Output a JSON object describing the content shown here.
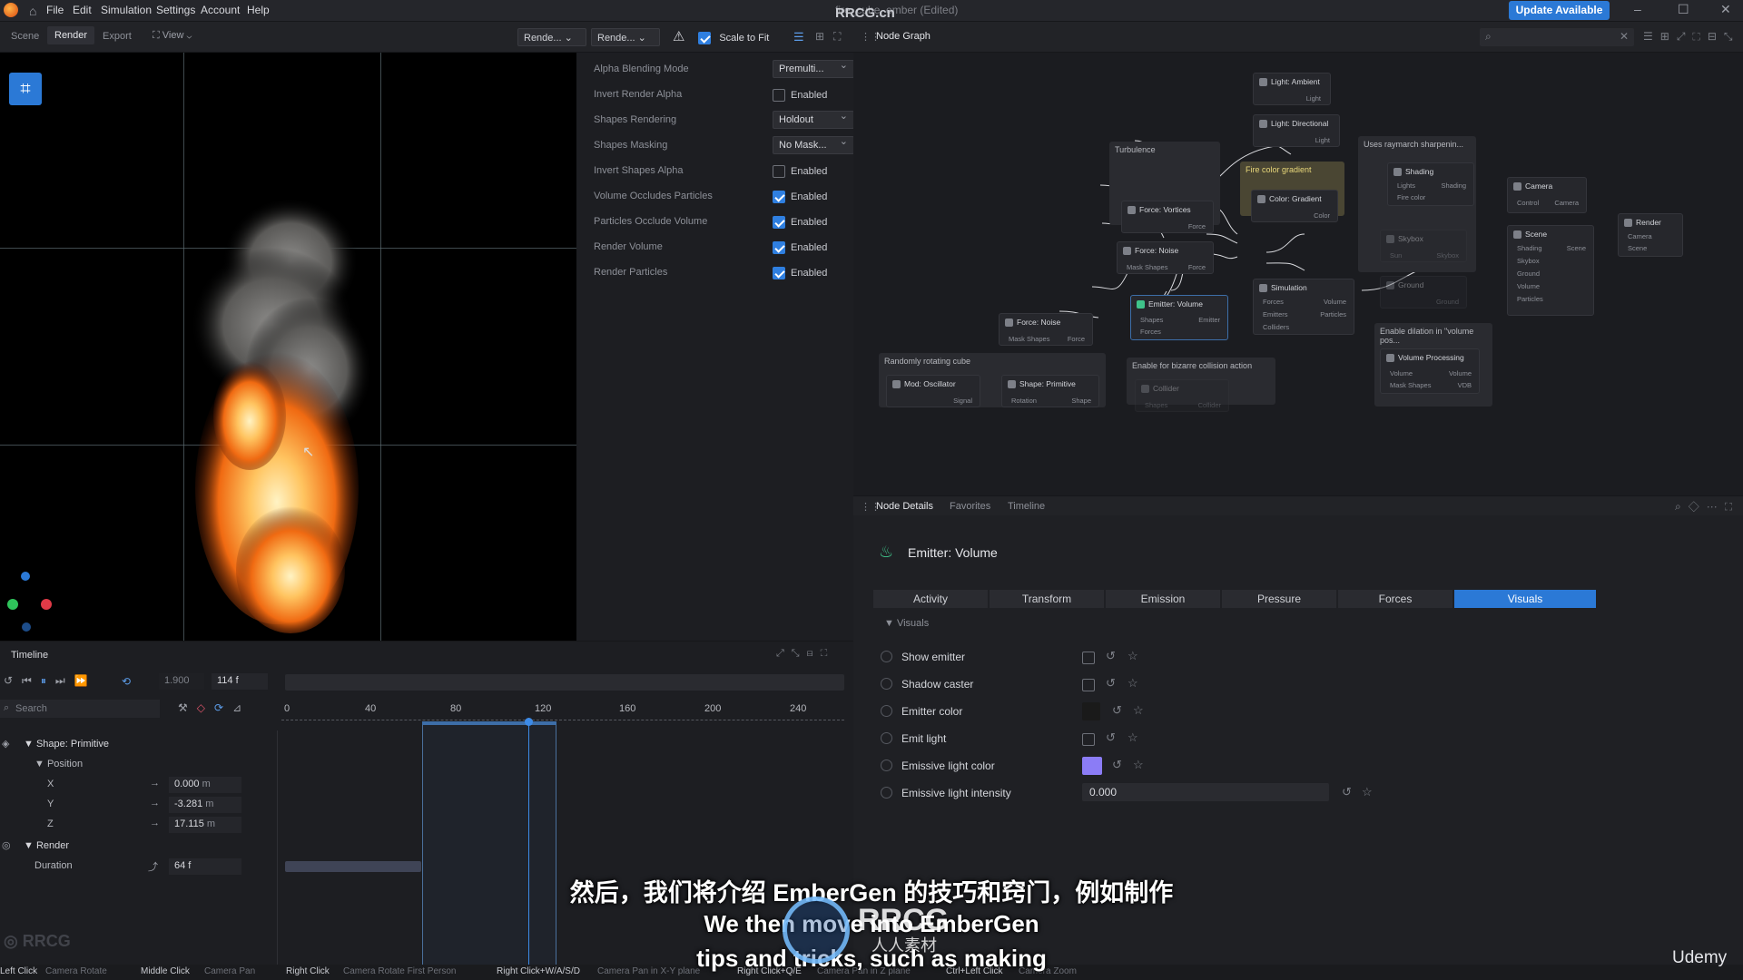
{
  "menubar": {
    "items": [
      "File",
      "Edit",
      "Simulation",
      "Settings",
      "Account",
      "Help"
    ],
    "window_title": "fire_cube_ember (Edited)",
    "watermark": "RRCG.cn",
    "update_button": "Update Available"
  },
  "left_toolbar": {
    "tabs": [
      "Scene",
      "Render",
      "Export"
    ],
    "active_tab": "Render",
    "view_label": "View",
    "dropdown1": "Rende...",
    "dropdown2": "Rende...",
    "scale_to_fit": "Scale to Fit"
  },
  "render_settings": {
    "rows": [
      {
        "label": "Alpha Blending Mode",
        "type": "dropdown",
        "value": "Premulti..."
      },
      {
        "label": "Invert Render Alpha",
        "type": "check",
        "checked": false,
        "value": "Enabled"
      },
      {
        "label": "Shapes Rendering",
        "type": "dropdown",
        "value": "Holdout"
      },
      {
        "label": "Shapes Masking",
        "type": "dropdown",
        "value": "No Mask..."
      },
      {
        "label": "Invert Shapes Alpha",
        "type": "check",
        "checked": false,
        "value": "Enabled"
      },
      {
        "label": "Volume Occludes Particles",
        "type": "check",
        "checked": true,
        "value": "Enabled"
      },
      {
        "label": "Particles Occlude Volume",
        "type": "check",
        "checked": true,
        "value": "Enabled"
      },
      {
        "label": "Render Volume",
        "type": "check",
        "checked": true,
        "value": "Enabled"
      },
      {
        "label": "Render Particles",
        "type": "check",
        "checked": true,
        "value": "Enabled"
      }
    ]
  },
  "node_graph": {
    "title": "Node Graph",
    "groups": {
      "turbulence": "Turbulence",
      "fire_color": "Fire color gradient",
      "raymarch": "Uses raymarch sharpenin...",
      "rotating_cube": "Randomly rotating cube",
      "bizarre": "Enable for bizarre collision action",
      "dilation": "Enable dilation in \"volume pos..."
    },
    "nodes": {
      "ambient": {
        "title": "Light: Ambient",
        "out": "Light"
      },
      "directional": {
        "title": "Light: Directional",
        "out": "Light"
      },
      "shading": {
        "title": "Shading",
        "in1": "Lights",
        "in2": "Fire color",
        "out": "Shading"
      },
      "camera": {
        "title": "Camera",
        "in": "Control",
        "out": "Camera"
      },
      "render": {
        "title": "Render",
        "in1": "Camera",
        "in2": "Scene"
      },
      "vortices": {
        "title": "Force: Vortices",
        "out": "Force"
      },
      "noise1": {
        "title": "Force: Noise",
        "in": "Mask Shapes",
        "out": "Force"
      },
      "gradient": {
        "title": "Color: Gradient",
        "out": "Color"
      },
      "skybox": {
        "title": "Skybox",
        "in": "Sun",
        "out": "Skybox"
      },
      "scene": {
        "title": "Scene",
        "in": [
          "Shading",
          "Skybox",
          "Ground",
          "Volume",
          "Particles"
        ],
        "out": "Scene"
      },
      "ground": {
        "title": "Ground",
        "out": "Ground"
      },
      "simulation": {
        "title": "Simulation",
        "in": [
          "Forces",
          "Emitters",
          "Colliders"
        ],
        "out": [
          "Volume",
          "Particles"
        ]
      },
      "noise2": {
        "title": "Force: Noise",
        "in": "Mask Shapes",
        "out": "Force"
      },
      "emitter": {
        "title": "Emitter: Volume",
        "in": [
          "Shapes",
          "Forces"
        ],
        "out": "Emitter"
      },
      "oscillator": {
        "title": "Mod: Oscillator",
        "out": "Signal"
      },
      "primitive": {
        "title": "Shape: Primitive",
        "in": "Rotation",
        "out": "Shape"
      },
      "collider": {
        "title": "Collider",
        "in": "Shapes",
        "out": "Collider"
      },
      "volproc": {
        "title": "Volume Processing",
        "in": [
          "Volume",
          "Mask Shapes"
        ],
        "out": [
          "Volume",
          "VDB"
        ]
      }
    }
  },
  "node_details": {
    "tabs": [
      "Node Details",
      "Favorites",
      "Timeline"
    ],
    "node_title": "Emitter: Volume",
    "subtabs": [
      "Activity",
      "Transform",
      "Emission",
      "Pressure",
      "Forces",
      "Visuals"
    ],
    "active_subtab": "Visuals",
    "section": "Visuals",
    "props": [
      {
        "label": "Show emitter",
        "type": "check"
      },
      {
        "label": "Shadow caster",
        "type": "check"
      },
      {
        "label": "Emitter color",
        "type": "color",
        "color": "#1a1a1a"
      },
      {
        "label": "Emit light",
        "type": "check"
      },
      {
        "label": "Emissive light color",
        "type": "color",
        "color": "#8b7cf6"
      },
      {
        "label": "Emissive light intensity",
        "type": "number",
        "value": "0.000"
      }
    ]
  },
  "timeline": {
    "title": "Timeline",
    "speed": "1.900",
    "frame": "114 f",
    "search_placeholder": "Search",
    "ruler": [
      "0",
      "40",
      "80",
      "120",
      "160",
      "200",
      "240"
    ],
    "tracks": {
      "shape": "Shape: Primitive",
      "position": "Position",
      "x_label": "X",
      "x_value": "0.000",
      "x_unit": "m",
      "y_label": "Y",
      "y_value": "-3.281",
      "y_unit": "m",
      "z_label": "Z",
      "z_value": "17.115",
      "z_unit": "m",
      "render": "Render",
      "duration_label": "Duration",
      "duration_value": "64 f"
    }
  },
  "statusbar": [
    {
      "key": "Left Click",
      "action": "Camera Rotate"
    },
    {
      "key": "Middle Click",
      "action": "Camera Pan"
    },
    {
      "key": "Right Click",
      "action": "Camera Rotate First Person"
    },
    {
      "key": "Right Click+W/A/S/D",
      "action": "Camera Pan in X-Y plane"
    },
    {
      "key": "Right Click+Q/E",
      "action": "Camera Pan in Z plane"
    },
    {
      "key": "Ctrl+Left Click",
      "action": "Camera Zoom"
    }
  ],
  "subtitles": {
    "zh": "然后，我们将介绍 EmberGen 的技巧和窍门，例如制作",
    "en1": "We then move into EmberGen",
    "en2": "tips and tricks, such as making",
    "brand": "Udemy",
    "logo_text": "RRCG",
    "logo_sub": "人人素材"
  },
  "colors": {
    "accent": "#2b79d6",
    "fire": "#ff8a1c"
  }
}
